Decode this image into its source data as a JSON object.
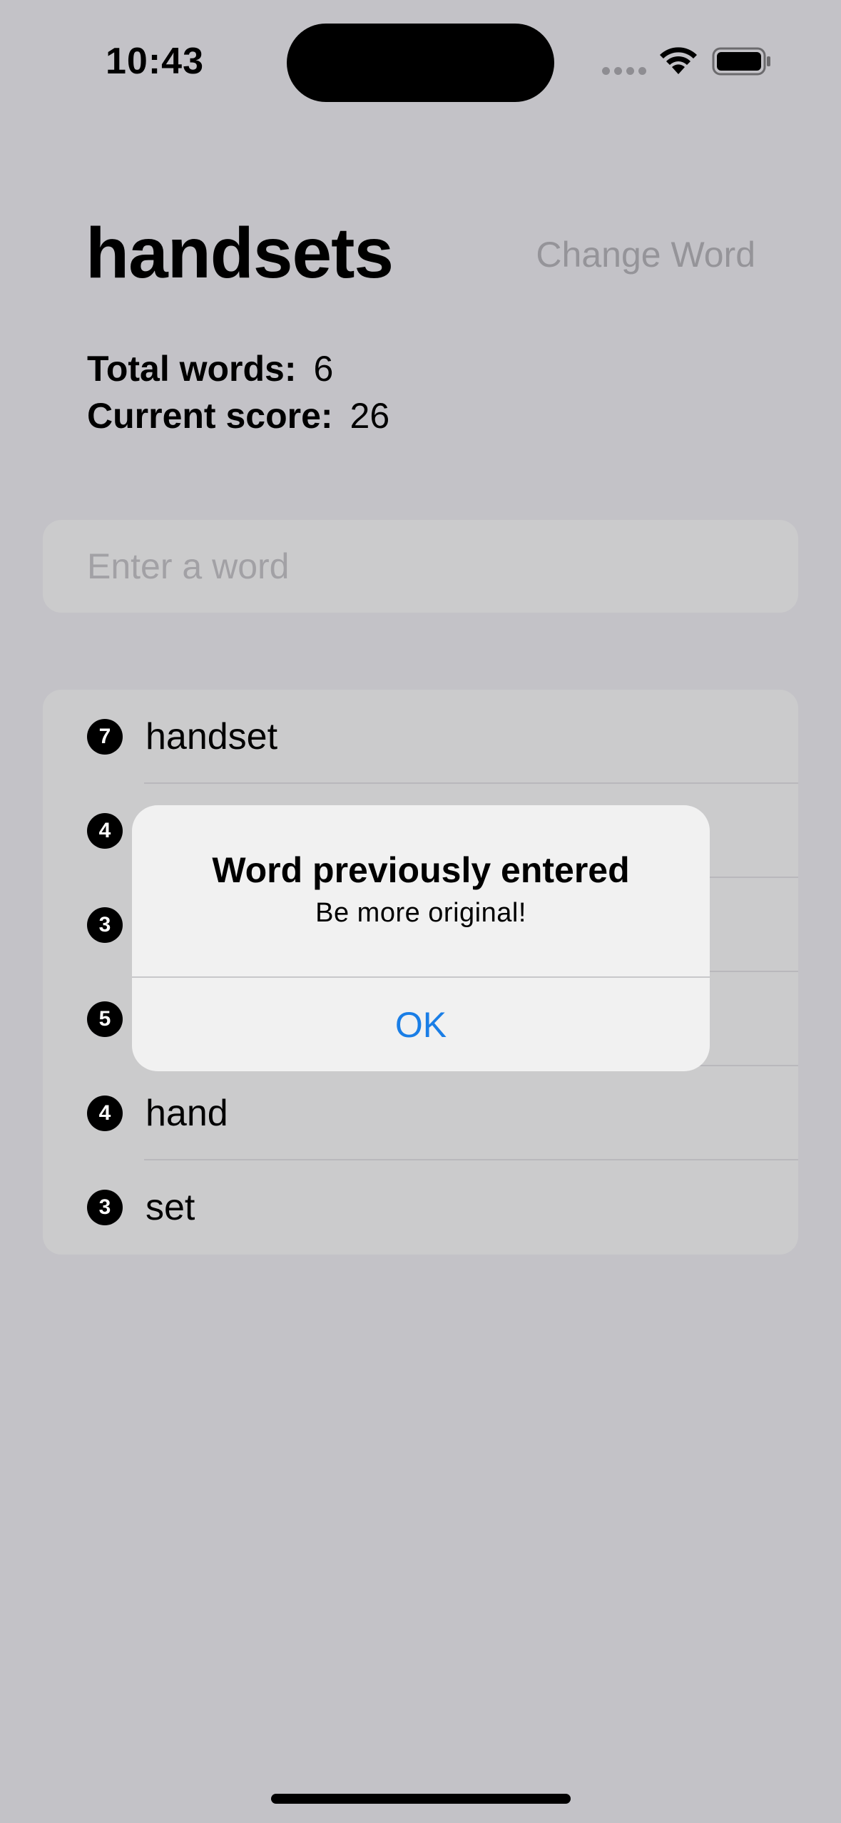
{
  "status_bar": {
    "time": "10:43"
  },
  "header": {
    "root_word": "handsets",
    "change_word_label": "Change Word"
  },
  "stats": {
    "total_words_label": "Total words:",
    "total_words_value": "6",
    "current_score_label": "Current score:",
    "current_score_value": "26"
  },
  "input": {
    "placeholder": "Enter a word",
    "value": ""
  },
  "used_words": [
    {
      "count": "7",
      "word": "handset"
    },
    {
      "count": "4",
      "word": ""
    },
    {
      "count": "3",
      "word": ""
    },
    {
      "count": "5",
      "word": ""
    },
    {
      "count": "4",
      "word": "hand"
    },
    {
      "count": "3",
      "word": "set"
    }
  ],
  "alert": {
    "title": "Word previously entered",
    "message": "Be more original!",
    "ok_label": "OK"
  },
  "colors": {
    "background": "#c3c2c7",
    "card": "#cbcbcc",
    "alert_background": "#f1f1f1",
    "accent_blue": "#1a7ee6",
    "muted_text": "#959499"
  }
}
